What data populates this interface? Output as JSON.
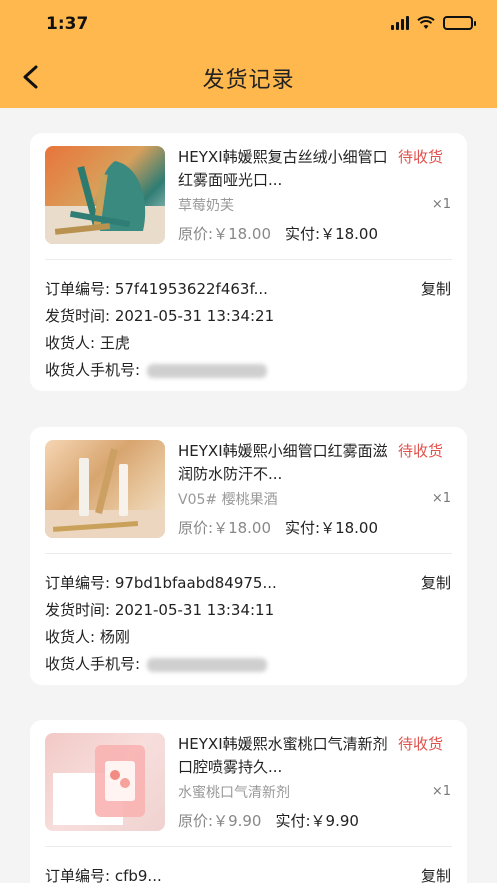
{
  "status_bar": {
    "time": "1:37"
  },
  "header": {
    "title": "发货记录"
  },
  "labels": {
    "order_no": "订单编号: ",
    "ship_time": "发货时间: ",
    "receiver": "收货人: ",
    "phone": "收货人手机号: ",
    "copy": "复制",
    "original_price": "原价:",
    "paid": "实付:"
  },
  "orders": [
    {
      "name": "HEYXI韩媛熙复古丝绒小细管口红雾面哑光口...",
      "status": "待收货",
      "spec": "草莓奶芙",
      "qty": "×1",
      "original_price": "￥18.00",
      "paid_price": "￥18.00",
      "order_no": "57f41953622f463f...",
      "ship_time": "2021-05-31 13:34:21",
      "receiver": "王虎"
    },
    {
      "name": "HEYXI韩媛熙小细管口红雾面滋润防水防汗不...",
      "status": "待收货",
      "spec": "V05# 樱桃果酒",
      "qty": "×1",
      "original_price": "￥18.00",
      "paid_price": "￥18.00",
      "order_no": "97bd1bfaabd84975...",
      "ship_time": "2021-05-31 13:34:11",
      "receiver": "杨刚"
    },
    {
      "name": "HEYXI韩媛熙水蜜桃口气清新剂口腔喷雾持久...",
      "status": "待收货",
      "spec": "水蜜桃口气清新剂",
      "qty": "×1",
      "original_price": "￥9.90",
      "paid_price": "￥9.90",
      "order_no": "cfb9..."
    }
  ]
}
